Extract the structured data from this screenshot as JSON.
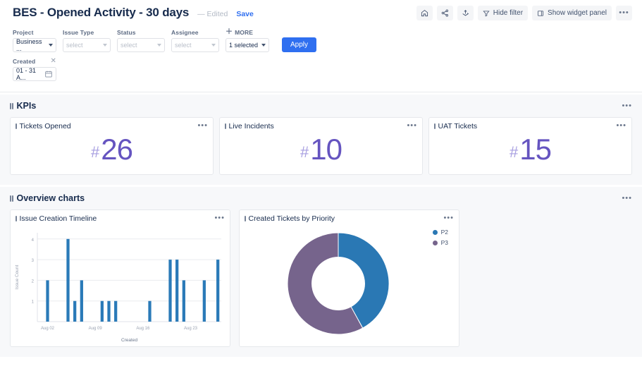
{
  "header": {
    "title": "BES - Opened Activity - 30 days",
    "edited_label": "— Edited",
    "save_label": "Save",
    "tools": [
      {
        "name": "home-icon",
        "label": ""
      },
      {
        "name": "share-icon",
        "label": ""
      },
      {
        "name": "export-icon",
        "label": ""
      },
      {
        "name": "hide-filter",
        "label": "Hide filter"
      },
      {
        "name": "show-widget-panel",
        "label": "Show widget panel"
      },
      {
        "name": "more-menu",
        "label": "•••"
      }
    ]
  },
  "filters": {
    "project": {
      "label": "Project",
      "value": "Business ..."
    },
    "issue_type": {
      "label": "Issue Type",
      "placeholder": "select"
    },
    "status": {
      "label": "Status",
      "placeholder": "select"
    },
    "assignee": {
      "label": "Assignee",
      "placeholder": "select"
    },
    "more": {
      "label": "MORE",
      "value": "1 selected"
    },
    "apply_label": "Apply",
    "created": {
      "label": "Created",
      "value": "01 - 31 A...",
      "clear": "✕"
    }
  },
  "sections": [
    {
      "id": "kpis",
      "title": "KPIs",
      "menu": "•••"
    },
    {
      "id": "overview",
      "title": "Overview charts",
      "menu": "•••"
    }
  ],
  "kpis": [
    {
      "title": "Tickets Opened",
      "hash": "#",
      "value": "26",
      "menu": "•••"
    },
    {
      "title": "Live Incidents",
      "hash": "#",
      "value": "10",
      "menu": "•••"
    },
    {
      "title": "UAT Tickets",
      "hash": "#",
      "value": "15",
      "menu": "•••"
    }
  ],
  "charts": [
    {
      "title": "Issue Creation Timeline",
      "menu": "•••"
    },
    {
      "title": "Created Tickets by Priority",
      "menu": "•••"
    }
  ],
  "colors": {
    "bar_blue": "#2a7ab8",
    "donut_blue": "#2a78b4",
    "donut_purple": "#76648c",
    "kpi_purple": "#6554c0",
    "kpi_hash": "#a79ee0",
    "accent_blue": "#2f6ff0"
  },
  "chart_data": [
    {
      "type": "bar",
      "title": "Issue Creation Timeline",
      "xlabel": "Created",
      "ylabel": "Issue Count",
      "ylim": [
        0,
        4.3
      ],
      "yticks": [
        1,
        2,
        3,
        4
      ],
      "xticks": [
        "Aug 02",
        "Aug 09",
        "Aug 16",
        "Aug 23"
      ],
      "xtick_positions": [
        1,
        8,
        15,
        22
      ],
      "grid": true,
      "categories": [
        "Aug 01",
        "Aug 02",
        "Aug 03",
        "Aug 04",
        "Aug 05",
        "Aug 06",
        "Aug 07",
        "Aug 08",
        "Aug 09",
        "Aug 10",
        "Aug 11",
        "Aug 12",
        "Aug 13",
        "Aug 14",
        "Aug 15",
        "Aug 16",
        "Aug 17",
        "Aug 18",
        "Aug 19",
        "Aug 20",
        "Aug 21",
        "Aug 22",
        "Aug 23",
        "Aug 24",
        "Aug 25",
        "Aug 26",
        "Aug 27"
      ],
      "values": [
        0,
        2,
        0,
        0,
        4,
        1,
        2,
        0,
        0,
        1,
        1,
        1,
        0,
        0,
        0,
        0,
        1,
        0,
        0,
        3,
        3,
        2,
        0,
        0,
        2,
        0,
        3
      ],
      "series_color": "#2a7ab8"
    },
    {
      "type": "pie",
      "subtype": "donut",
      "title": "Created Tickets by Priority",
      "legend_position": "top-right",
      "labels": [
        "P2",
        "P3"
      ],
      "values": [
        42,
        58
      ],
      "colors": [
        "#2a78b4",
        "#76648c"
      ],
      "inner_radius_ratio": 0.52
    }
  ]
}
